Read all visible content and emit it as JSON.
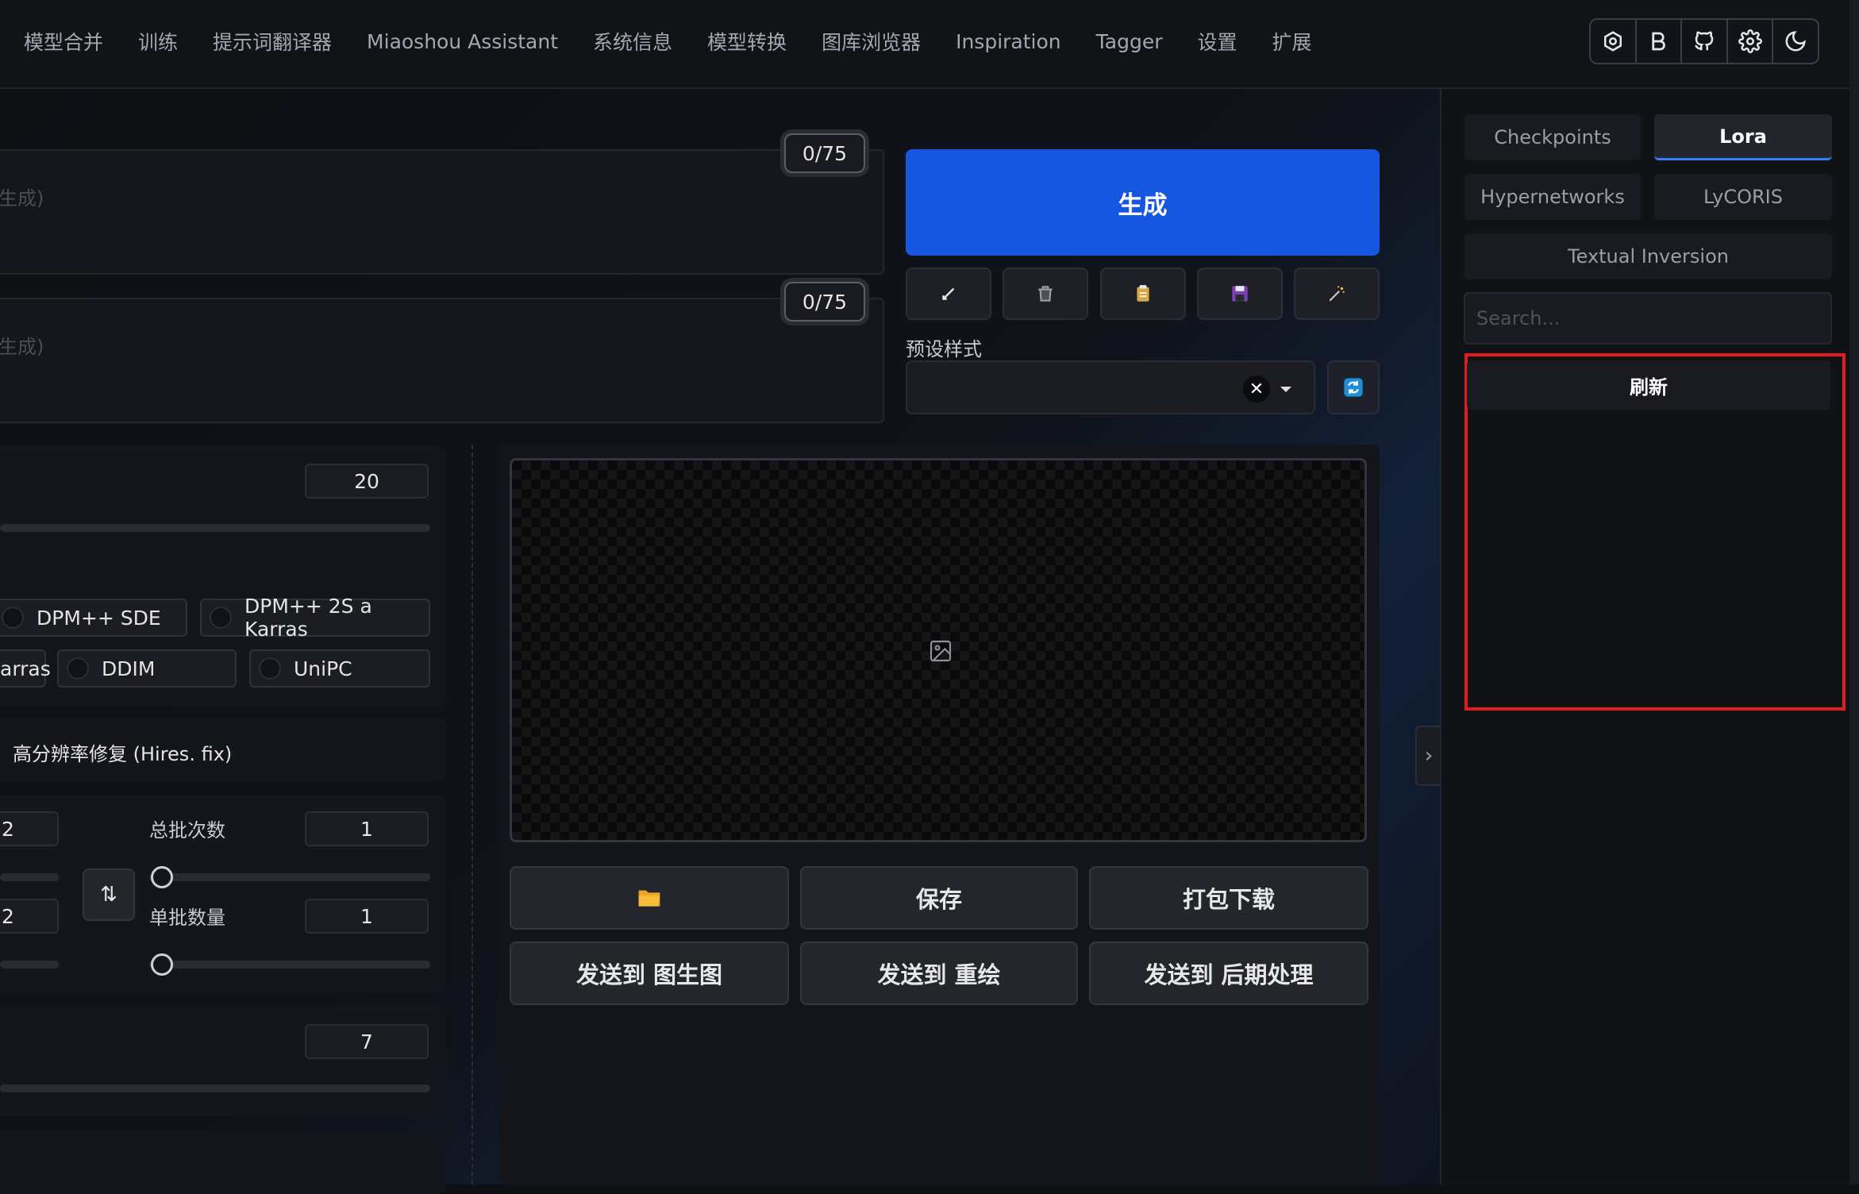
{
  "nav": {
    "items": [
      "模型合并",
      "训练",
      "提示词翻译器",
      "Miaoshou Assistant",
      "系统信息",
      "模型转换",
      "图库浏览器",
      "Inspiration",
      "Tagger",
      "设置",
      "扩展"
    ]
  },
  "header_icons": [
    "openai-icon",
    "bold-b-icon",
    "github-icon",
    "gear-icon",
    "moon-icon"
  ],
  "prompts": {
    "positive_placeholder": "生成)",
    "negative_placeholder": "生成)",
    "positive_counter": "0/75",
    "negative_counter": "0/75"
  },
  "actions": {
    "generate_label": "生成",
    "tool_icons": [
      "arrow-icon",
      "trash-icon",
      "clipboard-icon",
      "save-icon",
      "magic-wand-icon"
    ]
  },
  "preset": {
    "label": "预设样式",
    "clear_glyph": "✕"
  },
  "settings": {
    "steps_value": "20",
    "samplers_row1": [
      "DPM++ SDE",
      "DPM++ 2S a Karras"
    ],
    "samplers_row2": [
      "arras",
      "DDIM",
      "UniPC"
    ],
    "hires_label": "高分辨率修复 (Hires. fix)",
    "width_value": "2",
    "height_value": "2",
    "batch_count_label": "总批次数",
    "batch_count_value": "1",
    "batch_size_label": "单批数量",
    "batch_size_value": "1",
    "swap_glyph": "⇅",
    "cfg_value": "7"
  },
  "output": {
    "folder_icon": "folder-icon",
    "save_label": "保存",
    "zip_label": "打包下载",
    "send_img2img": "发送到 图生图",
    "send_inpaint": "发送到 重绘",
    "send_extras": "发送到 后期处理"
  },
  "right_panel": {
    "tabs": [
      "Checkpoints",
      "Lora",
      "Hypernetworks",
      "LyCORIS",
      "Textual Inversion"
    ],
    "active_tab": "Lora",
    "search_placeholder": "Search...",
    "refresh_label": "刷新",
    "collapse_glyph": "›"
  },
  "colors": {
    "accent": "#1756e0",
    "highlight_box": "#e21b1b",
    "active_tab_underline": "#3b7bff"
  }
}
